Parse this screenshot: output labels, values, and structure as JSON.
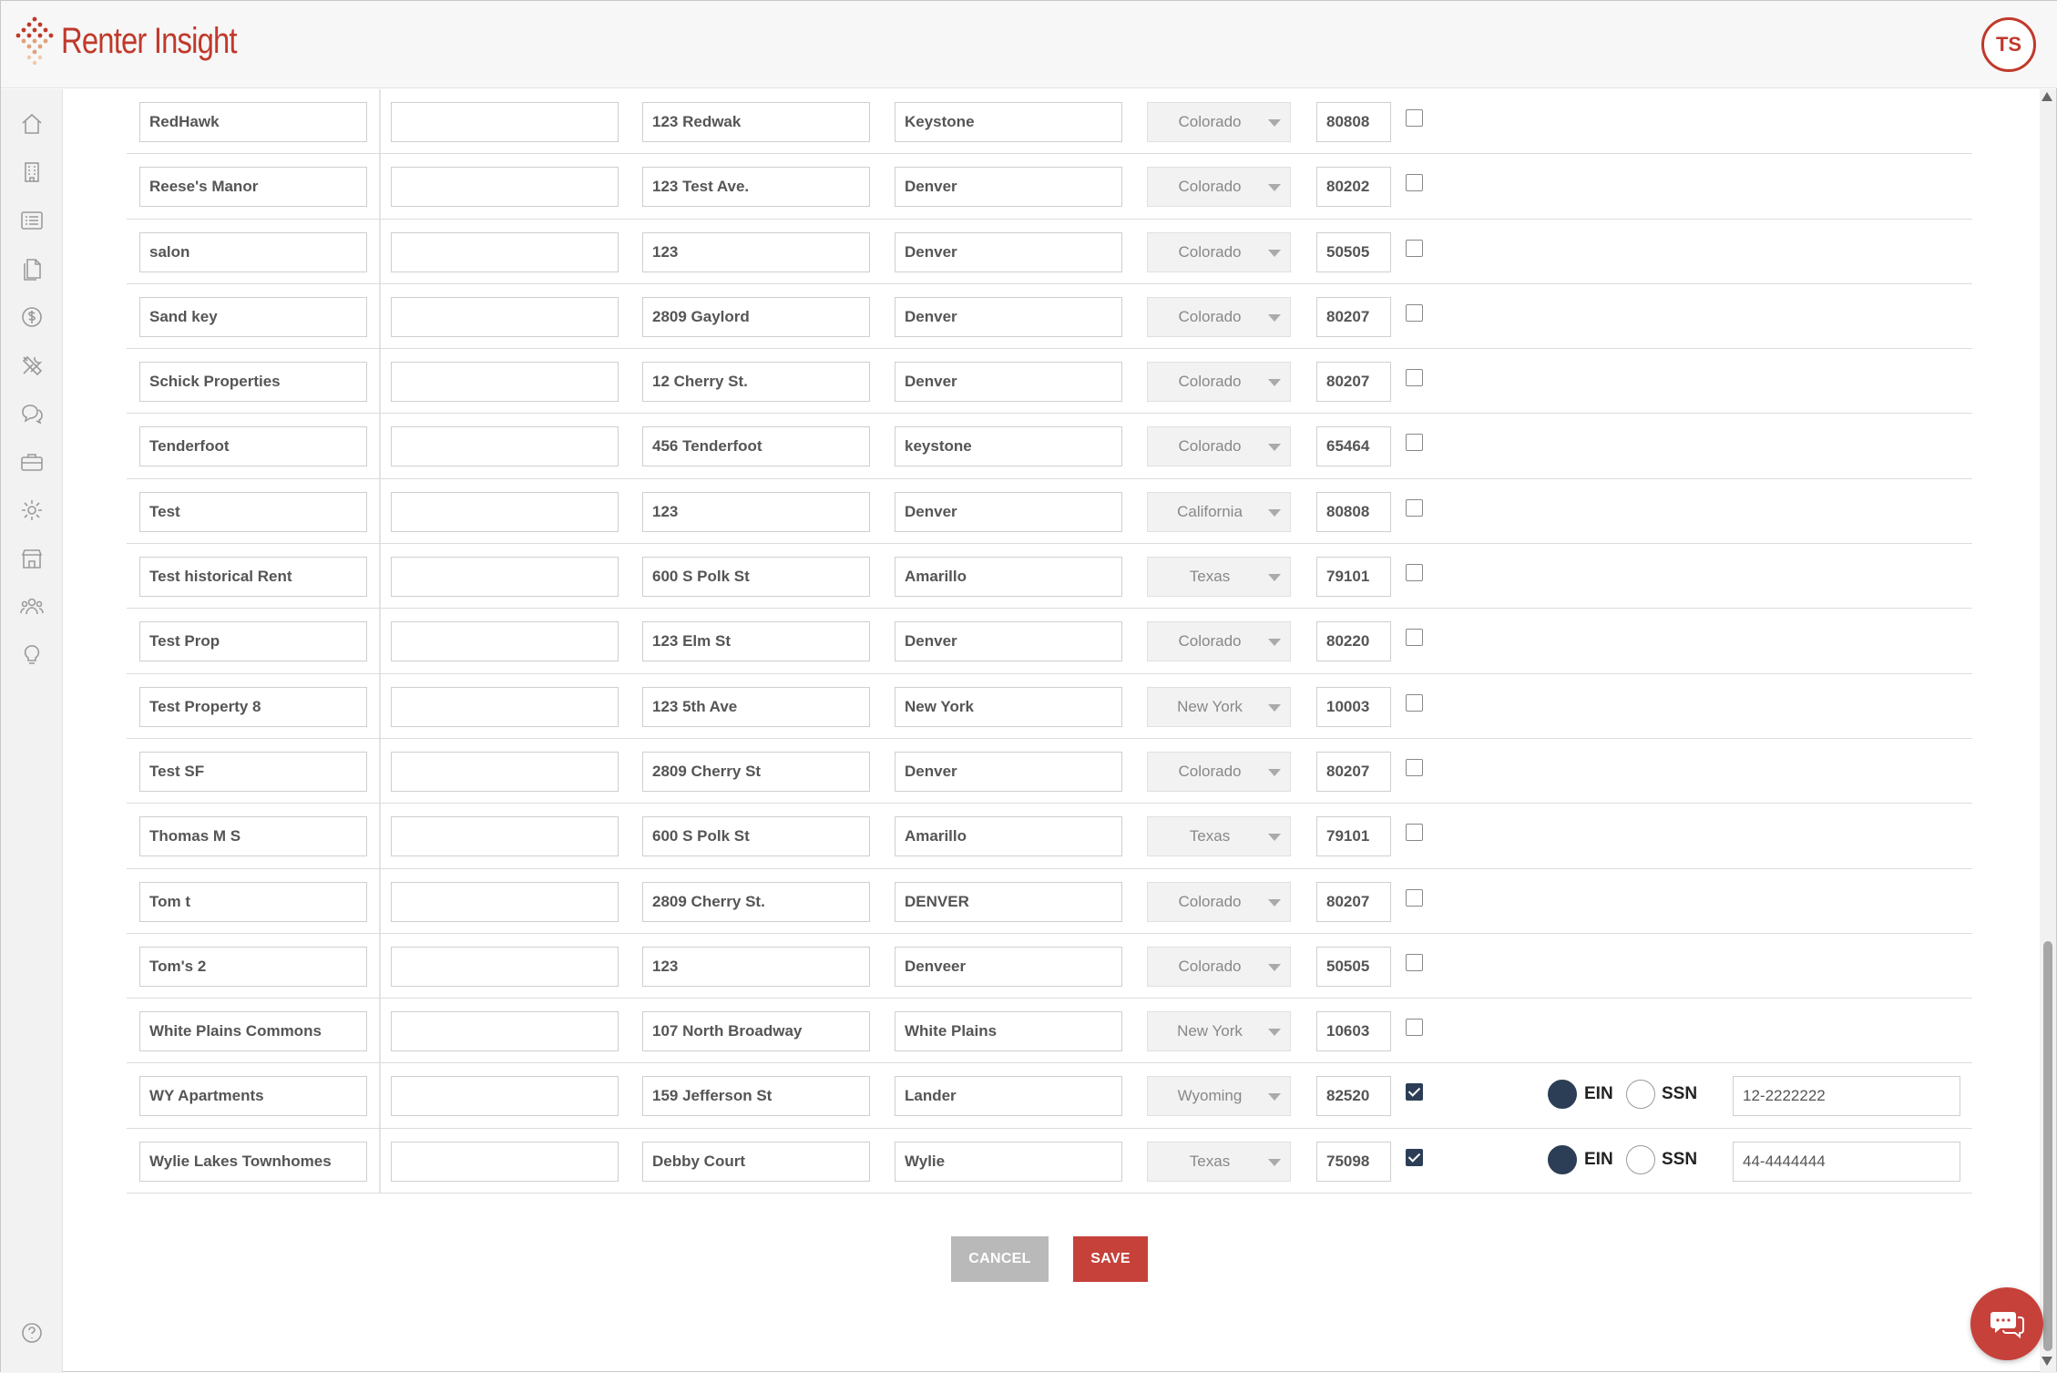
{
  "app": {
    "name": "Renter Insight",
    "user_initials": "TS",
    "brand_color": "#c0392b"
  },
  "sidebar": {
    "icons": [
      "home-icon",
      "building-icon",
      "list-icon",
      "documents-icon",
      "dollar-icon",
      "tools-icon",
      "chat-bubbles-icon",
      "briefcase-icon",
      "gear-icon",
      "storefront-icon",
      "people-icon",
      "lightbulb-icon",
      "help-icon"
    ]
  },
  "rows": [
    {
      "name": "RedHawk",
      "address": "123 Redwak",
      "city": "Keystone",
      "state": "Colorado",
      "zip": "80808",
      "checked": false
    },
    {
      "name": "Reese's Manor",
      "address": "123 Test Ave.",
      "city": "Denver",
      "state": "Colorado",
      "zip": "80202",
      "checked": false
    },
    {
      "name": "salon",
      "address": "123",
      "city": "Denver",
      "state": "Colorado",
      "zip": "50505",
      "checked": false
    },
    {
      "name": "Sand key",
      "address": "2809 Gaylord",
      "city": "Denver",
      "state": "Colorado",
      "zip": "80207",
      "checked": false
    },
    {
      "name": "Schick Properties",
      "address": "12 Cherry St.",
      "city": "Denver",
      "state": "Colorado",
      "zip": "80207",
      "checked": false
    },
    {
      "name": "Tenderfoot",
      "address": "456 Tenderfoot",
      "city": "keystone",
      "state": "Colorado",
      "zip": "65464",
      "checked": false
    },
    {
      "name": "Test",
      "address": "123",
      "city": "Denver",
      "state": "California",
      "zip": "80808",
      "checked": false
    },
    {
      "name": "Test historical Rent",
      "address": "600 S Polk St",
      "city": "Amarillo",
      "state": "Texas",
      "zip": "79101",
      "checked": false
    },
    {
      "name": "Test Prop",
      "address": "123 Elm St",
      "city": "Denver",
      "state": "Colorado",
      "zip": "80220",
      "checked": false
    },
    {
      "name": "Test Property 8",
      "address": "123 5th Ave",
      "city": "New York",
      "state": "New York",
      "zip": "10003",
      "checked": false
    },
    {
      "name": "Test SF",
      "address": "2809 Cherry St",
      "city": "Denver",
      "state": "Colorado",
      "zip": "80207",
      "checked": false
    },
    {
      "name": "Thomas M S",
      "address": "600 S Polk St",
      "city": "Amarillo",
      "state": "Texas",
      "zip": "79101",
      "checked": false
    },
    {
      "name": "Tom t",
      "address": "2809 Cherry St.",
      "city": "DENVER",
      "state": "Colorado",
      "zip": "80207",
      "checked": false
    },
    {
      "name": "Tom's 2",
      "address": "123",
      "city": "Denveer",
      "state": "Colorado",
      "zip": "50505",
      "checked": false
    },
    {
      "name": "White Plains Commons",
      "address": "107 North Broadway",
      "city": "White Plains",
      "state": "New York",
      "zip": "10603",
      "checked": false
    },
    {
      "name": "WY Apartments",
      "address": "159 Jefferson St",
      "city": "Lander",
      "state": "Wyoming",
      "zip": "82520",
      "checked": true,
      "tax_type": "EIN",
      "tax_id": "12-2222222"
    },
    {
      "name": "Wylie Lakes Townhomes",
      "address": "Debby Court",
      "city": "Wylie",
      "state": "Texas",
      "zip": "75098",
      "checked": true,
      "tax_type": "EIN",
      "tax_id": "44-4444444"
    }
  ],
  "radio_labels": {
    "ein": "EIN",
    "ssn": "SSN"
  },
  "actions": {
    "cancel": "CANCEL",
    "save": "SAVE"
  },
  "colors": {
    "accent": "#c6413a",
    "selected": "#2c3e55",
    "cancel": "#b9b9b9"
  }
}
